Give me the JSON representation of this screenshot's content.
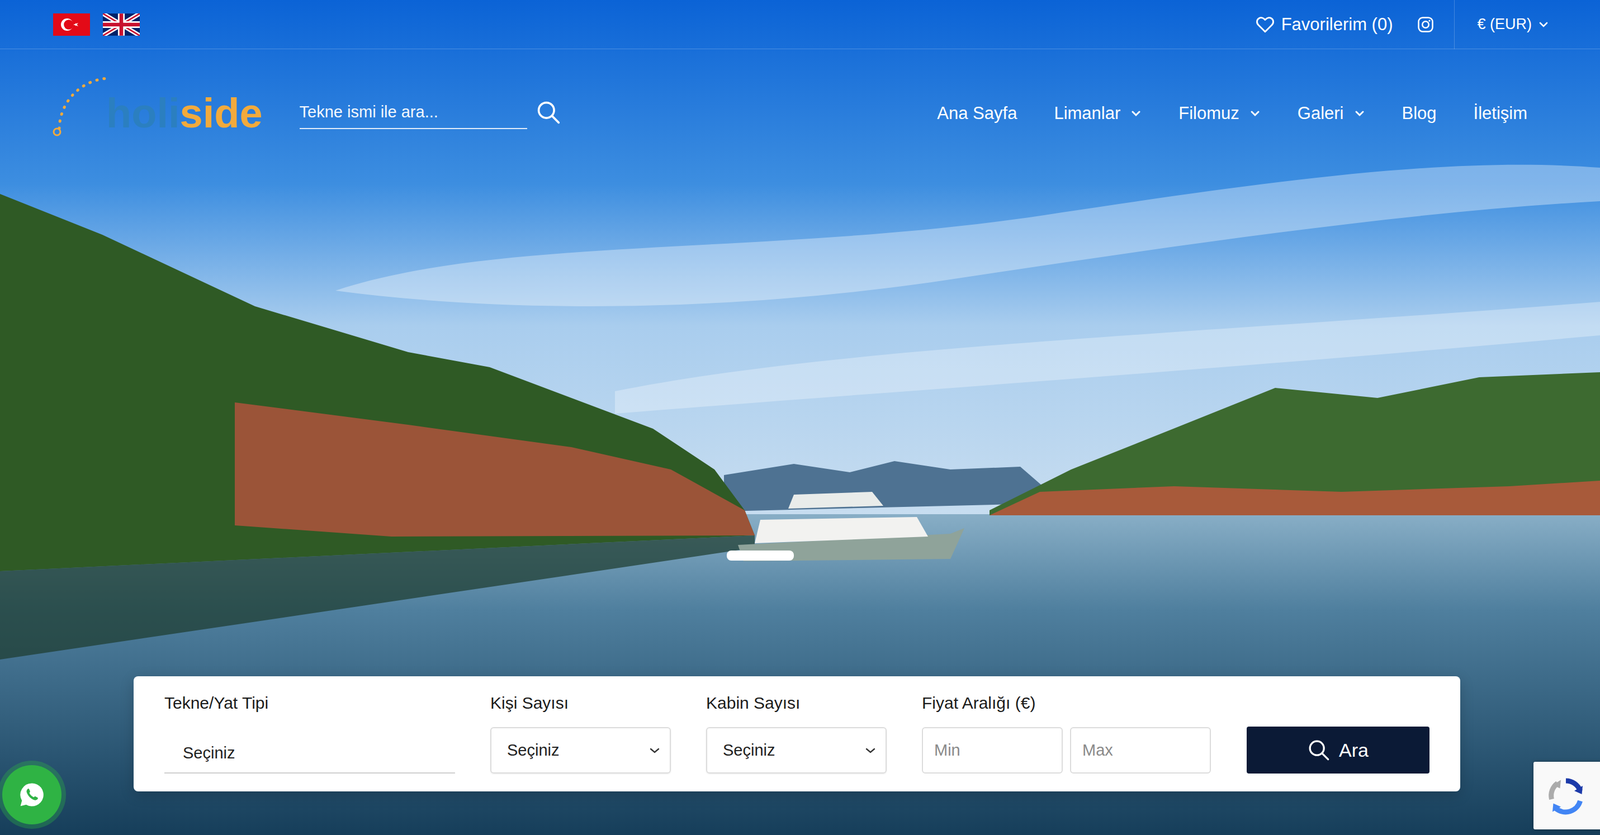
{
  "topbar": {
    "favorites": "Favorilerim (0)",
    "currency": "€ (EUR)"
  },
  "logo": {
    "part1": "holi",
    "part2": "side"
  },
  "search": {
    "placeholder": "Tekne ismi ile ara..."
  },
  "nav": [
    {
      "label": "Ana Sayfa",
      "has_menu": false
    },
    {
      "label": "Limanlar",
      "has_menu": true
    },
    {
      "label": "Filomuz",
      "has_menu": true
    },
    {
      "label": "Galeri",
      "has_menu": true
    },
    {
      "label": "Blog",
      "has_menu": false
    },
    {
      "label": "İletişim",
      "has_menu": false
    }
  ],
  "filters": {
    "fields": [
      {
        "label": "Tekne/Yat Tipi",
        "kind": "underline",
        "value": "Seçiniz"
      },
      {
        "label": "Kişi Sayısı",
        "kind": "select",
        "value": "Seçiniz"
      },
      {
        "label": "Kabin Sayısı",
        "kind": "select",
        "value": "Seçiniz"
      },
      {
        "label": "Fiyat Aralığı (€)",
        "kind": "range",
        "min_placeholder": "Min",
        "max_placeholder": "Max"
      }
    ],
    "button": "Ara"
  }
}
